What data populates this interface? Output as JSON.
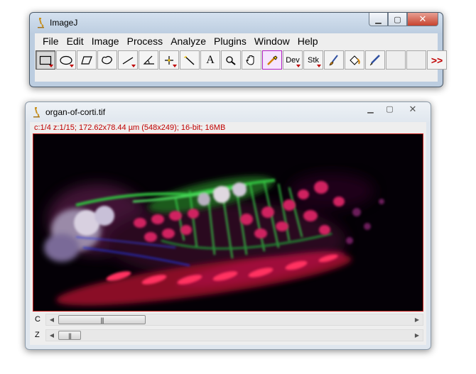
{
  "imagej_window": {
    "title": "ImageJ",
    "menu": [
      "File",
      "Edit",
      "Image",
      "Process",
      "Analyze",
      "Plugins",
      "Window",
      "Help"
    ],
    "tools": [
      {
        "name": "rectangle-tool",
        "label": "",
        "dropdown": true,
        "selected": true
      },
      {
        "name": "oval-tool",
        "label": "",
        "dropdown": true
      },
      {
        "name": "polygon-tool",
        "label": ""
      },
      {
        "name": "freehand-tool",
        "label": ""
      },
      {
        "name": "line-tool",
        "label": "",
        "dropdown": true
      },
      {
        "name": "angle-tool",
        "label": ""
      },
      {
        "name": "point-tool",
        "label": "",
        "dropdown": true
      },
      {
        "name": "wand-tool",
        "label": ""
      },
      {
        "name": "text-tool",
        "label": "A"
      },
      {
        "name": "zoom-tool",
        "label": ""
      },
      {
        "name": "hand-tool",
        "label": ""
      },
      {
        "name": "color-picker-tool",
        "label": ""
      },
      {
        "name": "dev-menu",
        "label": "Dev",
        "dropdown": true
      },
      {
        "name": "stk-menu",
        "label": "Stk",
        "dropdown": true
      },
      {
        "name": "brush-tool",
        "label": ""
      },
      {
        "name": "flood-fill-tool",
        "label": ""
      },
      {
        "name": "pencil-tool",
        "label": ""
      },
      {
        "name": "blank-slot-1",
        "label": ""
      },
      {
        "name": "blank-slot-2",
        "label": ""
      },
      {
        "name": "more-tools",
        "label": ">>"
      }
    ]
  },
  "image_window": {
    "title": "organ-of-corti.tif",
    "status": "c:1/4 z:1/15; 172.62x78.44 µm (548x249); 16-bit; 16MB",
    "scrollbars": [
      {
        "label": "C",
        "value": 1,
        "max": 4
      },
      {
        "label": "Z",
        "value": 1,
        "max": 15
      }
    ]
  },
  "colors": {
    "status_text": "#c00000",
    "image_border": "#cc2222",
    "dropdown_indicator": "#c00000"
  }
}
